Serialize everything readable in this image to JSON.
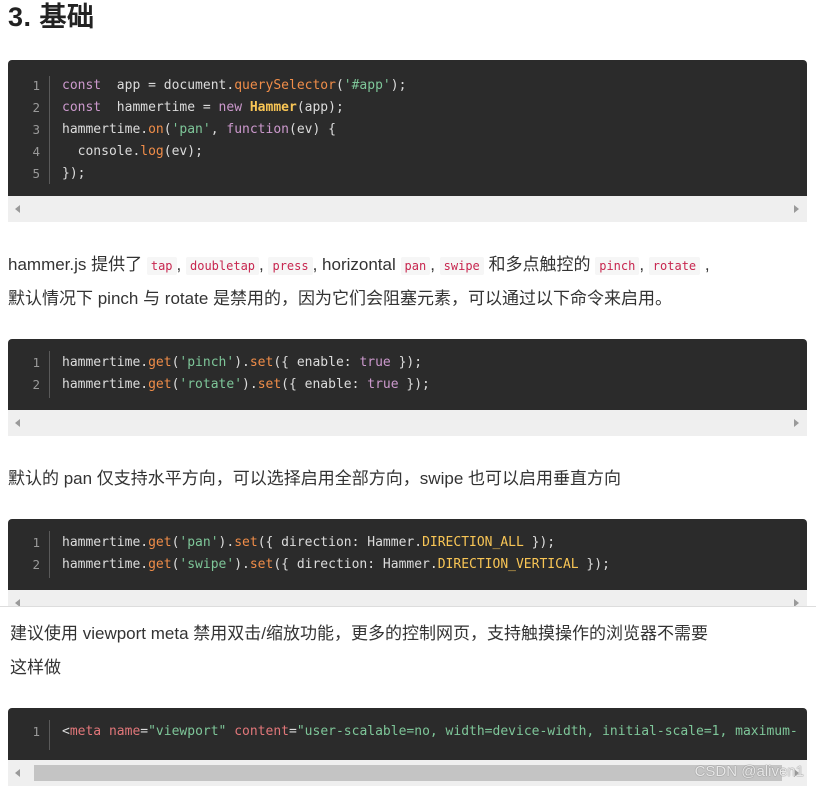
{
  "heading": "3. 基础",
  "block1": {
    "lines": [
      {
        "n": "1",
        "parts": [
          [
            "kw",
            "const"
          ],
          [
            "",
            "  app = document."
          ],
          [
            "fn",
            "querySelector"
          ],
          [
            "",
            "("
          ],
          [
            "str",
            "'#app'"
          ],
          [
            "",
            ");"
          ]
        ]
      },
      {
        "n": "2",
        "parts": [
          [
            "kw",
            "const"
          ],
          [
            "",
            "  hammertime = "
          ],
          [
            "kw",
            "new"
          ],
          [
            "",
            " "
          ],
          [
            "cls",
            "Hammer"
          ],
          [
            "",
            "(app);"
          ]
        ]
      },
      {
        "n": "3",
        "parts": [
          [
            "",
            "hammertime."
          ],
          [
            "fn",
            "on"
          ],
          [
            "",
            "("
          ],
          [
            "str",
            "'pan'"
          ],
          [
            "",
            ", "
          ],
          [
            "kw",
            "function"
          ],
          [
            "",
            "(ev) {"
          ]
        ]
      },
      {
        "n": "4",
        "parts": [
          [
            "",
            "  console."
          ],
          [
            "fn",
            "log"
          ],
          [
            "",
            "(ev);"
          ]
        ]
      },
      {
        "n": "5",
        "parts": [
          [
            "",
            "});"
          ]
        ]
      }
    ]
  },
  "para1": {
    "line1": [
      [
        "t",
        "hammer.js 提供了 "
      ],
      [
        "c",
        "tap"
      ],
      [
        "t",
        ", "
      ],
      [
        "c",
        "doubletap"
      ],
      [
        "t",
        ", "
      ],
      [
        "c",
        "press"
      ],
      [
        "t",
        ", horizontal "
      ],
      [
        "c",
        "pan"
      ],
      [
        "t",
        ", "
      ],
      [
        "c",
        "swipe"
      ],
      [
        "t",
        " 和多点触控的 "
      ],
      [
        "c",
        "pinch"
      ],
      [
        "t",
        ", "
      ],
      [
        "c",
        "rotate"
      ],
      [
        "t",
        " ,"
      ]
    ],
    "line2": "默认情况下 pinch 与 rotate 是禁用的，因为它们会阻塞元素，可以通过以下命令来启用。"
  },
  "block2": {
    "lines": [
      {
        "n": "1",
        "parts": [
          [
            "",
            "hammertime."
          ],
          [
            "fn",
            "get"
          ],
          [
            "",
            "("
          ],
          [
            "str",
            "'pinch'"
          ],
          [
            "",
            ")."
          ],
          [
            "fn",
            "set"
          ],
          [
            "",
            "({ enable: "
          ],
          [
            "kw",
            "true"
          ],
          [
            "",
            " });"
          ]
        ]
      },
      {
        "n": "2",
        "parts": [
          [
            "",
            "hammertime."
          ],
          [
            "fn",
            "get"
          ],
          [
            "",
            "("
          ],
          [
            "str",
            "'rotate'"
          ],
          [
            "",
            ")."
          ],
          [
            "fn",
            "set"
          ],
          [
            "",
            "({ enable: "
          ],
          [
            "kw",
            "true"
          ],
          [
            "",
            " });"
          ]
        ]
      }
    ]
  },
  "para2": "默认的 pan 仅支持水平方向，可以选择启用全部方向，swipe 也可以启用垂直方向",
  "block3": {
    "lines": [
      {
        "n": "1",
        "parts": [
          [
            "",
            "hammertime."
          ],
          [
            "fn",
            "get"
          ],
          [
            "",
            "("
          ],
          [
            "str",
            "'pan'"
          ],
          [
            "",
            ")."
          ],
          [
            "fn",
            "set"
          ],
          [
            "",
            "({ direction: Hammer."
          ],
          [
            "const",
            "DIRECTION_ALL"
          ],
          [
            "",
            " });"
          ]
        ]
      },
      {
        "n": "2",
        "parts": [
          [
            "",
            "hammertime."
          ],
          [
            "fn",
            "get"
          ],
          [
            "",
            "("
          ],
          [
            "str",
            "'swipe'"
          ],
          [
            "",
            ")."
          ],
          [
            "fn",
            "set"
          ],
          [
            "",
            "({ direction: Hammer."
          ],
          [
            "const",
            "DIRECTION_VERTICAL"
          ],
          [
            "",
            " });"
          ]
        ]
      }
    ]
  },
  "para3": {
    "line1": "建议使用 viewport meta 禁用双击/缩放功能，更多的控制网页，支持触摸操作的浏览器不需要",
    "line2": "这样做"
  },
  "block4": {
    "lines": [
      {
        "n": "1",
        "parts": [
          [
            "",
            "<"
          ],
          [
            "tag",
            "meta"
          ],
          [
            "",
            " "
          ],
          [
            "attr",
            "name"
          ],
          [
            "",
            "="
          ],
          [
            "str",
            "\"viewport\""
          ],
          [
            "",
            " "
          ],
          [
            "attr",
            "content"
          ],
          [
            "",
            "="
          ],
          [
            "str",
            "\"user-scalable=no, width=device-width, initial-scale=1, maximum-"
          ]
        ]
      }
    ]
  },
  "watermark": "CSDN @aliven1"
}
